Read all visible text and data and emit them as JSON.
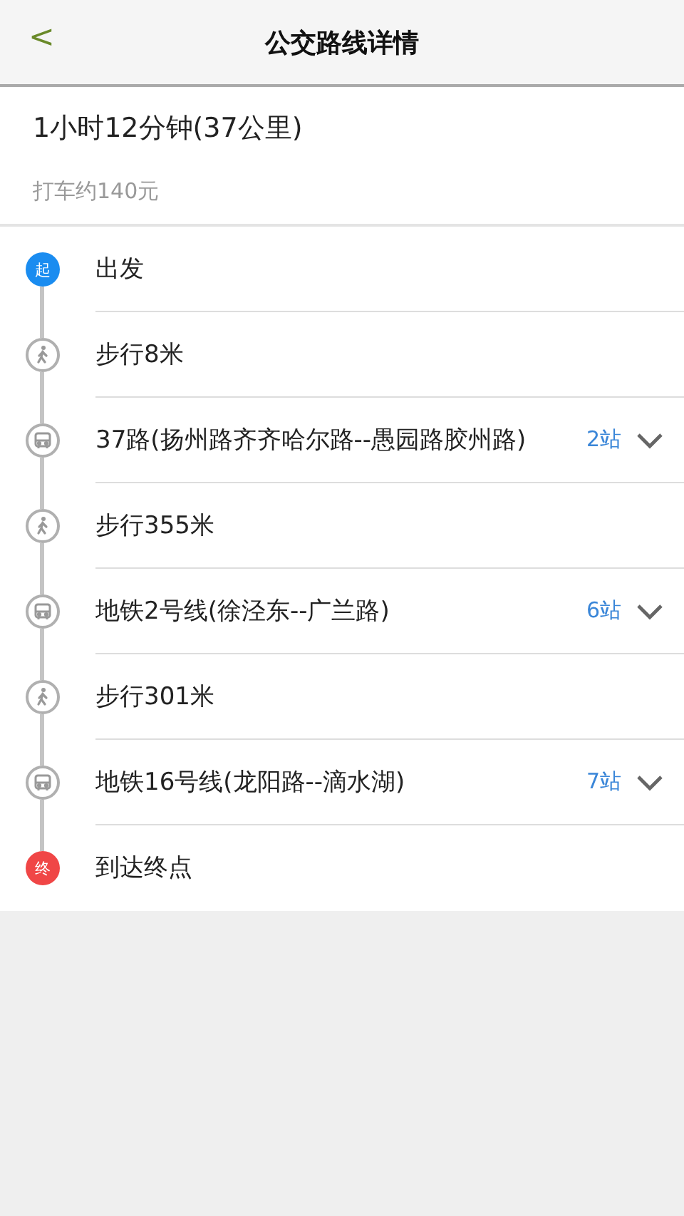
{
  "header": {
    "back": "<",
    "title": "公交路线详情"
  },
  "summary": {
    "duration": "1小时12分钟(37公里)",
    "taxi": "打车约140元"
  },
  "steps": [
    {
      "kind": "start",
      "marker": "起",
      "text": "出发"
    },
    {
      "kind": "walk",
      "text": "步行8米"
    },
    {
      "kind": "bus",
      "text": "37路(扬州路齐齐哈尔路--愚园路胶州路)",
      "stops": "2站"
    },
    {
      "kind": "walk",
      "text": "步行355米"
    },
    {
      "kind": "bus",
      "text": "地铁2号线(徐泾东--广兰路)",
      "stops": "6站"
    },
    {
      "kind": "walk",
      "text": "步行301米"
    },
    {
      "kind": "bus",
      "text": "地铁16号线(龙阳路--滴水湖)",
      "stops": "7站"
    },
    {
      "kind": "end",
      "marker": "终",
      "text": "到达终点"
    }
  ]
}
